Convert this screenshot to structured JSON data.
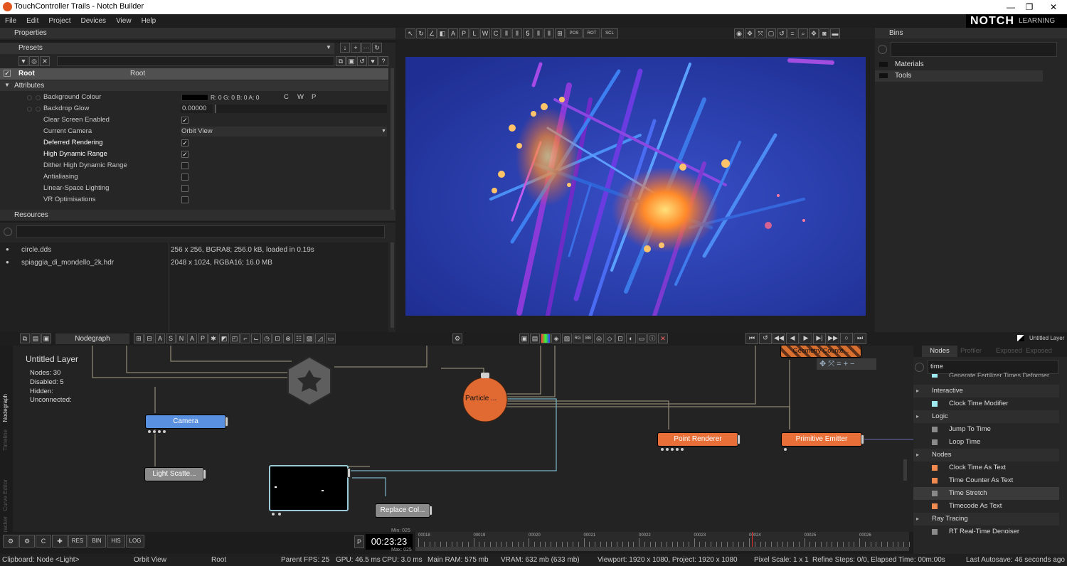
{
  "window": {
    "title": "TouchController Trails - Notch Builder",
    "minimize": "—",
    "restore": "❐",
    "close": "✕"
  },
  "menu": [
    "File",
    "Edit",
    "Project",
    "Devices",
    "View",
    "Help"
  ],
  "logo": {
    "brand": "NOTCH",
    "sub": "LEARNING"
  },
  "properties": {
    "header": "Properties",
    "presets": "Presets",
    "root_name": "Root",
    "root_value": "Root",
    "section": "Attributes",
    "background_colour": {
      "label": "Background Colour",
      "value": "R: 0 G: 0 B: 0 A: 0",
      "c": "C",
      "w": "W",
      "p": "P",
      "swatch": "#000000"
    },
    "backdrop_glow": {
      "label": "Backdrop Glow",
      "value": "0.00000"
    },
    "clear_screen": {
      "label": "Clear Screen Enabled",
      "checked": true
    },
    "current_camera": {
      "label": "Current Camera",
      "value": "Orbit View"
    },
    "deferred": {
      "label": "Deferred Rendering",
      "checked": true
    },
    "hdr": {
      "label": "High Dynamic Range",
      "checked": true
    },
    "dither": {
      "label": "Dither High Dynamic Range",
      "checked": false
    },
    "aa": {
      "label": "Antialiasing",
      "checked": false
    },
    "linear": {
      "label": "Linear-Space Lighting",
      "checked": false
    },
    "vr": {
      "label": "VR Optimisations",
      "checked": false
    }
  },
  "resources": {
    "header": "Resources",
    "items": [
      {
        "name": "circle.dds",
        "info": "256 x 256, BGRA8; 256.0 kB, loaded in 0.19s"
      },
      {
        "name": "spiaggia_di_mondello_2k.hdr",
        "info": "2048 x 1024, RGBA16; 16.0 MB"
      }
    ]
  },
  "viewport_toolbar": {
    "frame_step": "5",
    "pos": "POS",
    "rot": "ROT",
    "scl": "SCL"
  },
  "bins": {
    "header": "Bins",
    "items": [
      "Materials",
      "Tools"
    ]
  },
  "nodegraph": {
    "tab": "Nodegraph",
    "snap": [
      "S",
      "N",
      "A",
      "P"
    ],
    "side_tabs": [
      "Nodegraph",
      "Timeline",
      "Curve Editor",
      "Tracker"
    ],
    "layer": {
      "title": "Untitled  Layer",
      "nodes": "Nodes:  30",
      "disabled": "Disabled:  5",
      "hidden": "Hidden:",
      "unconnected": "Unconnected:"
    },
    "node_labels": {
      "camera": "Camera",
      "light": "Light  Scatte...",
      "particle": "Particle  ...",
      "point": "Point  Renderer",
      "primitive": "Primitive  Emitter",
      "replace": "Replace  Col...",
      "geometry": "Geometry  Counte..."
    },
    "colors": {
      "camera": "#4a86d8",
      "orange": "#e06a32",
      "grey": "#7c7c7c"
    }
  },
  "untitled_layer_tab": "Untitled Layer",
  "node_browser": {
    "tabs": [
      "Nodes",
      "Profiler",
      "Exposed",
      "Exposed"
    ],
    "search": "time",
    "clipped": "Generate Fertilizer Times Deformer",
    "rows": [
      {
        "label": "Interactive",
        "category": true
      },
      {
        "label": "Clock Time Modifier",
        "color": "#9ee8f0"
      },
      {
        "label": "Logic",
        "category": true
      },
      {
        "label": "Jump To Time",
        "color": "#8a8a8a"
      },
      {
        "label": "Loop Time",
        "color": "#8a8a8a"
      },
      {
        "label": "Nodes",
        "category": true
      },
      {
        "label": "Clock Time As Text",
        "color": "#f08a50"
      },
      {
        "label": "Time Counter As Text",
        "color": "#f08a50"
      },
      {
        "label": "Time Stretch",
        "color": "#8a8a8a"
      },
      {
        "label": "Timecode As Text",
        "color": "#f08a50"
      },
      {
        "label": "Ray Tracing",
        "category": true
      },
      {
        "label": "RT Real-Time Denoiser",
        "color": "#8a8a8a"
      }
    ]
  },
  "bottom_buttons": [
    "RES",
    "BIN",
    "HIS",
    "LOG"
  ],
  "timeline": {
    "p": "P",
    "time": "00:23:23",
    "min": "Min: 025",
    "max": "Max: 025",
    "ticks": [
      "00018",
      "00019",
      "00020",
      "00021",
      "00022",
      "00023",
      "00024",
      "00025",
      "00026"
    ]
  },
  "status": {
    "clipboard": "Clipboard: Node <Light>",
    "camera": "Orbit View",
    "root": "Root",
    "parent": "Parent",
    "fps": "FPS: 25",
    "gpu": "GPU: 46.5 ms",
    "cpu": "CPU: 3.0 ms",
    "ram": "Main RAM: 575 mb",
    "vram": "VRAM: 632 mb (633 mb)",
    "viewport": "Viewport: 1920 x 1080, Project: 1920 x 1080",
    "pixel": "Pixel Scale: 1 x 1",
    "refine": "Refine Steps: 0/0, Elapsed Time: 00m:00s",
    "autosave": "Last Autosave: 46 seconds ago"
  }
}
